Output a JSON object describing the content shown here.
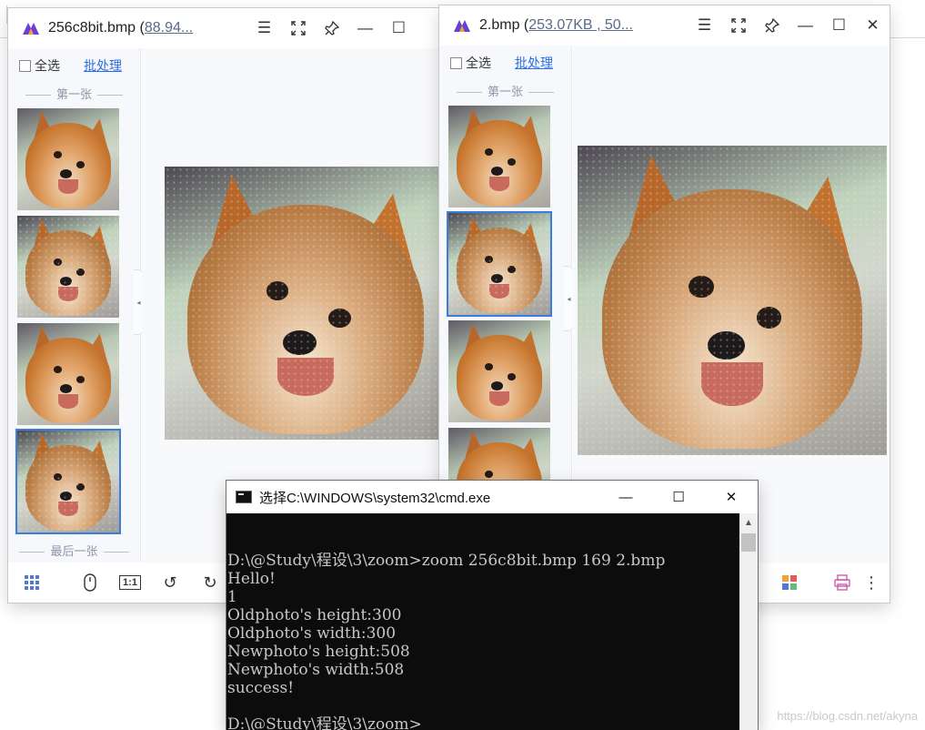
{
  "viewer1": {
    "title_name": "256c8bit.bmp (",
    "title_link": "88.94...",
    "select_all": "全选",
    "batch": "批处理",
    "first_label": "第一张",
    "last_label": "最后一张"
  },
  "viewer2": {
    "title_name": "2.bmp (",
    "title_link": "253.07KB , 50...",
    "select_all": "全选",
    "batch": "批处理",
    "first_label": "第一张"
  },
  "toolbar_icons": {
    "menu": "☰",
    "fullscreen": "⛶",
    "pin": "📌",
    "minimize": "—",
    "maximize": "☐",
    "close": "✕"
  },
  "bottom_icons": {
    "grid": "grid-icon",
    "mouse": "mouse-icon",
    "actual_size": "1:1",
    "rotate_left": "↺",
    "rotate_right": "↻",
    "print": "printer-icon",
    "more": "⋮"
  },
  "cmd": {
    "title": "选择C:\\WINDOWS\\system32\\cmd.exe",
    "lines": [
      "D:\\@Study\\程设\\3\\zoom>zoom 256c8bit.bmp 169 2.bmp",
      "Hello!",
      "1",
      "Oldphoto's height:300",
      "Oldphoto's width:300",
      "Newphoto's height:508",
      "Newphoto's width:508",
      "success!",
      "",
      "D:\\@Study\\程设\\3\\zoom>"
    ]
  },
  "watermark": "https://blog.csdn.net/akyna",
  "colors": {
    "accent": "#2b6de0",
    "selection": "#3b7ddd",
    "cmd_bg": "#0c0c0c",
    "cmd_text": "#c8c8c8"
  }
}
